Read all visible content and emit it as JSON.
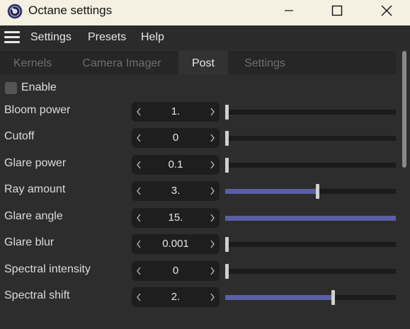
{
  "window": {
    "title": "Octane settings"
  },
  "menu": {
    "items": [
      "Settings",
      "Presets",
      "Help"
    ]
  },
  "tabs": {
    "items": [
      "Kernels",
      "Camera Imager",
      "Post",
      "Settings"
    ],
    "active": "Post"
  },
  "enable": {
    "label": "Enable",
    "checked": false
  },
  "params": [
    {
      "label": "Bloom power",
      "value": "1.",
      "slider_fraction": 0.0
    },
    {
      "label": "Cutoff",
      "value": "0",
      "slider_fraction": 0.0
    },
    {
      "label": "Glare power",
      "value": "0.1",
      "slider_fraction": 0.0
    },
    {
      "label": "Ray amount",
      "value": "3.",
      "slider_fraction": 0.54
    },
    {
      "label": "Glare angle",
      "value": "15.",
      "slider_fraction": 1.0
    },
    {
      "label": "Glare blur",
      "value": "0.001",
      "slider_fraction": 0.0
    },
    {
      "label": "Spectral intensity",
      "value": "0",
      "slider_fraction": 0.0
    },
    {
      "label": "Spectral shift",
      "value": "2.",
      "slider_fraction": 0.63
    }
  ],
  "colors": {
    "background": "#2d2d2d",
    "titlebar": "#f4f1e3",
    "slider_fill": "#5c5fa6",
    "slider_track": "#1b1b1b",
    "spin_bg": "#1e1e1e"
  },
  "icons": {
    "app": "octane-logo-icon",
    "minimize": "minimize-icon",
    "maximize": "maximize-icon",
    "close": "close-icon",
    "menu": "hamburger-menu-icon",
    "decrement": "chevron-left-icon",
    "increment": "chevron-right-icon"
  }
}
